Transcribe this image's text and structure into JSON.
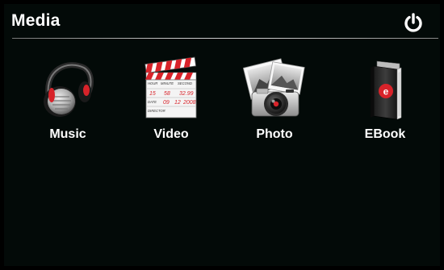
{
  "header": {
    "title": "Media",
    "power_icon": "power-icon"
  },
  "apps": [
    {
      "label": "Music",
      "icon": "headphones-icon"
    },
    {
      "label": "Video",
      "icon": "clapperboard-icon"
    },
    {
      "label": "Photo",
      "icon": "camera-photos-icon"
    },
    {
      "label": "EBook",
      "icon": "ebook-icon"
    }
  ],
  "clapperboard": {
    "row1": [
      "HOUR",
      "MINUTE",
      "SECOND"
    ],
    "row2": [
      "15",
      "58",
      "32.99"
    ],
    "row3_label": "DATE",
    "row3": [
      "09",
      "12",
      "2008"
    ],
    "row4_label": "DIRECTOR"
  },
  "colors": {
    "accent_red": "#d8232a",
    "background": "#030a08",
    "text": "#ffffff"
  }
}
